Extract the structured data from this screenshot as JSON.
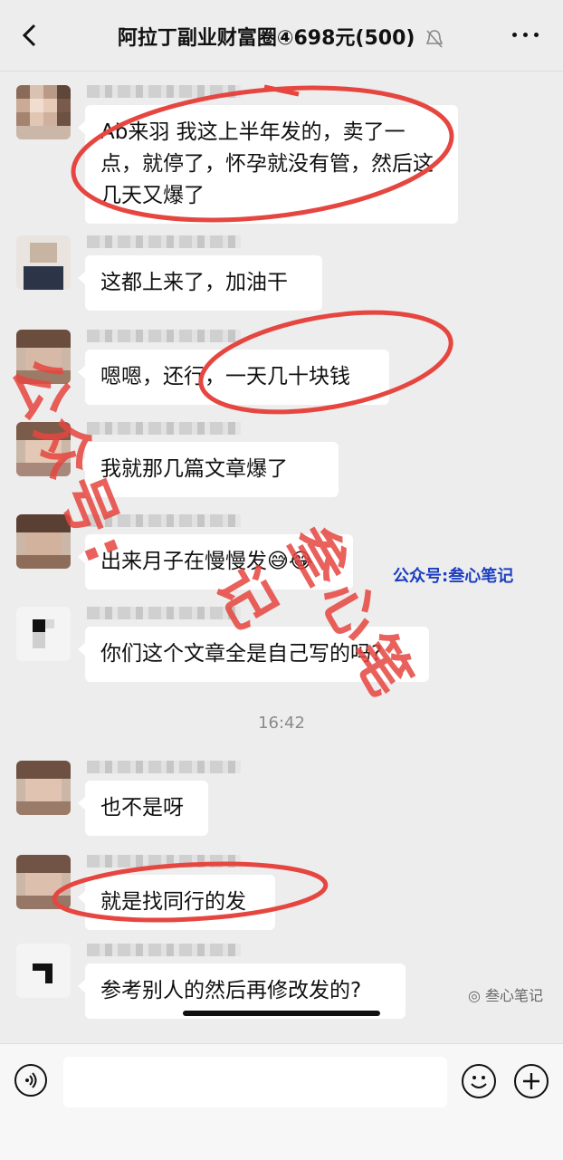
{
  "header": {
    "title": "阿拉丁副业财富圈④698元(500)"
  },
  "messages": [
    {
      "text": "Ab来羽 我这上半年发的，卖了一点，就停了，怀孕就没有管，然后这几天又爆了"
    },
    {
      "text": "这都上来了，加油干"
    },
    {
      "text": "嗯嗯，还行，一天几十块钱"
    },
    {
      "text": "我就那几篇文章爆了"
    },
    {
      "text": "出来月子在慢慢发😅😂"
    },
    {
      "text": "你们这个文章全是自己写的吗?"
    },
    {
      "text": "也不是呀"
    },
    {
      "text": "就是找同行的发"
    },
    {
      "text": "参考别人的然后再修改发的?"
    }
  ],
  "timestamp": "16:42",
  "input": {
    "placeholder": ""
  },
  "watermarks": {
    "red_line1": "公众号:",
    "red_line2": "叁心笔记",
    "blue": "公众号:叁心笔记",
    "footer": "叁心笔记"
  },
  "colors": {
    "annotation": "#e64640",
    "blue_watermark": "#1c3fbf",
    "bg": "#ededed"
  },
  "icons": [
    "back-icon",
    "mute-bell-icon",
    "more-icon",
    "voice-icon",
    "emoji-icon",
    "plus-icon"
  ]
}
